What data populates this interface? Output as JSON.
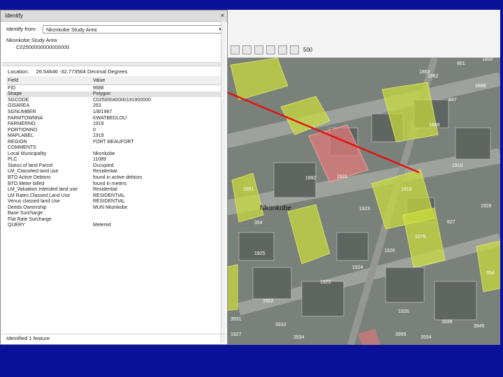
{
  "identify": {
    "title": "Identify",
    "close_glyph": "×",
    "from_label": "Identify from:",
    "from_value": "Nkonkobe Study Area",
    "dropdown_glyph": "▾",
    "tree_layer": "Nkonkobe Study Area",
    "tree_feature": "C02500000000000000",
    "location_label": "Location:",
    "location_value": "26.54646 -32.773564 Decimal Degrees",
    "col_field": "Field",
    "col_value": "Value",
    "rows": [
      {
        "f": "FID",
        "v": "9688"
      },
      {
        "f": "Shape",
        "v": "Polygon"
      },
      {
        "f": "SGCODE",
        "v": "C02500040000191900000"
      },
      {
        "f": "GISAREA",
        "v": "263"
      },
      {
        "f": "SGNUMBER",
        "v": "1/8/1987"
      },
      {
        "f": "FARMTOWNNA",
        "v": "KWATBEDLOU"
      },
      {
        "f": "FARMERNO",
        "v": "1919"
      },
      {
        "f": "PORTIONNO",
        "v": "0"
      },
      {
        "f": "MAPLABEL",
        "v": "1919"
      },
      {
        "f": "REGION",
        "v": "FORT BEAUFORT"
      },
      {
        "f": "COMMENTS",
        "v": ""
      },
      {
        "f": "Local Municipality",
        "v": "Nkonkobe"
      },
      {
        "f": "PLC",
        "v": "11089"
      },
      {
        "f": "Status of land Parcel",
        "v": "Occupied"
      },
      {
        "f": "LM_Classified land use",
        "v": "Residential"
      },
      {
        "f": "BTO Active Debtors",
        "v": "found in active debtors"
      },
      {
        "f": "BTO Meter billed",
        "v": "found in meters"
      },
      {
        "f": "LM_Valuation Intended land use",
        "v": "Residential"
      },
      {
        "f": "LM Rates Classed Land Use",
        "v": "RESIDENTIAL"
      },
      {
        "f": "Venus classed land Use",
        "v": "RESIDENTIAL"
      },
      {
        "f": "Deeds Ownership",
        "v": "MUN Nkonkobe"
      },
      {
        "f": "Base Surcharge",
        "v": ""
      },
      {
        "f": "Flat Rate Surcharge",
        "v": ""
      },
      {
        "f": "QUERY",
        "v": "Metered"
      }
    ],
    "status": "Identified 1 feature"
  },
  "map": {
    "scale_text": "500",
    "place_name": "Nkonkobe",
    "parcel_labels": [
      {
        "t": "861"
      },
      {
        "t": "1850"
      },
      {
        "t": "1863"
      },
      {
        "t": "1862"
      },
      {
        "t": "1888"
      },
      {
        "t": "847"
      },
      {
        "t": "1868"
      },
      {
        "t": "1919"
      },
      {
        "t": "1861"
      },
      {
        "t": "1892"
      },
      {
        "t": "1921"
      },
      {
        "t": "1910"
      },
      {
        "t": "1923"
      },
      {
        "t": "354"
      },
      {
        "t": "827"
      },
      {
        "t": "1928"
      },
      {
        "t": "1076"
      },
      {
        "t": "1926"
      },
      {
        "t": "1924"
      },
      {
        "t": "1925"
      },
      {
        "t": "1923"
      },
      {
        "t": "1922"
      },
      {
        "t": "354"
      },
      {
        "t": "3931"
      },
      {
        "t": "3933"
      },
      {
        "t": "1926"
      },
      {
        "t": "1927"
      },
      {
        "t": "3934"
      },
      {
        "t": "3945"
      },
      {
        "t": "3955"
      },
      {
        "t": "3934"
      },
      {
        "t": "3938"
      }
    ]
  },
  "colors": {
    "background": "#0a1199",
    "selection_line": "#e31010",
    "highlight_parcel": "#c9dc3a",
    "selected_parcel": "#e57a7a"
  }
}
